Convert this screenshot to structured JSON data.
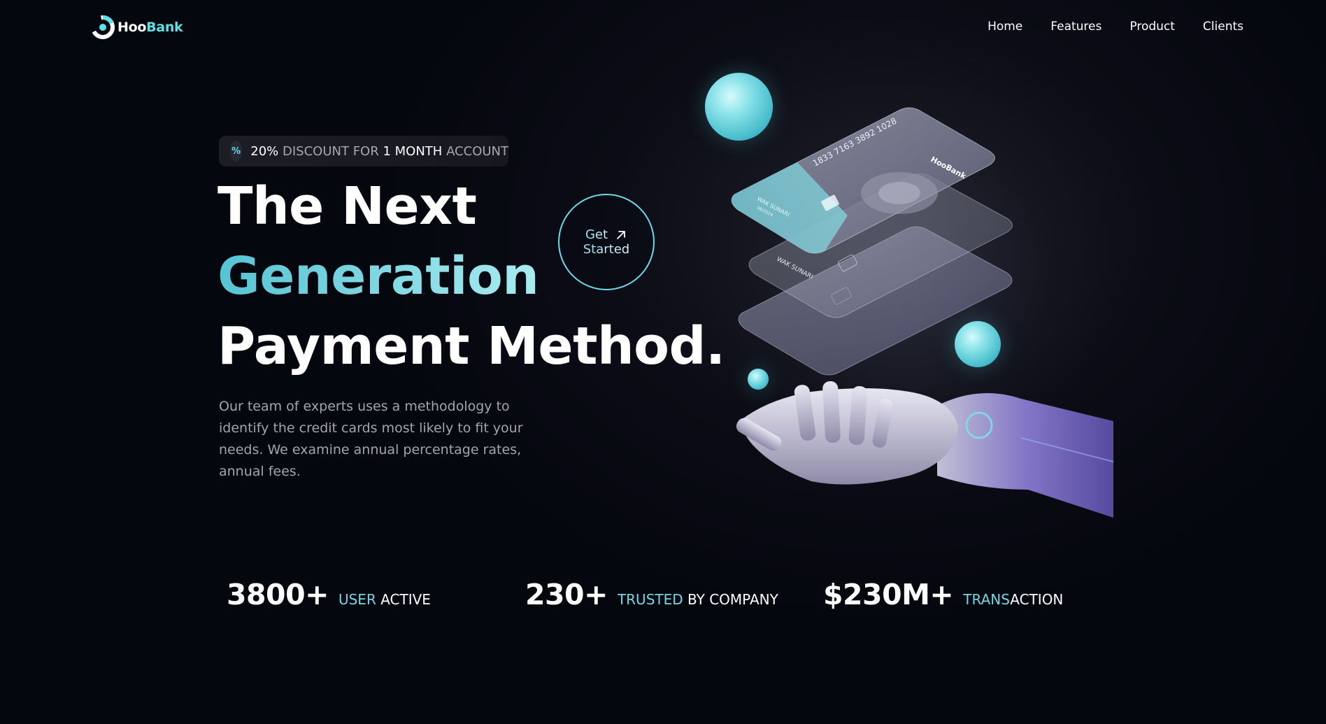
{
  "brand": {
    "name_part1": "Hoo",
    "name_part2": "Bank",
    "accent": "#5ce1e6"
  },
  "nav": {
    "items": [
      {
        "label": "Home"
      },
      {
        "label": "Features"
      },
      {
        "label": "Product"
      },
      {
        "label": "Clients"
      }
    ]
  },
  "hero": {
    "badge": {
      "icon": "discount-icon",
      "percent": "20%",
      "text1": "DISCOUNT FOR",
      "duration": "1 MONTH",
      "text2": "ACCOUNT"
    },
    "title_line1": "The Next",
    "title_line2": "Generation",
    "title_line3": "Payment Method.",
    "description": "Our team of experts uses a methodology to identify the credit cards most likely to fit your needs. We examine annual percentage rates, annual fees.",
    "cta": {
      "line1": "Get",
      "line2": "Started",
      "icon": "arrow-up-right-icon"
    }
  },
  "art": {
    "card_number": "1833 7163 3892 1028",
    "card_brand": "HooBank",
    "card_holder": "WAK SUNARI",
    "card_expiry": "08/2024"
  },
  "stats": [
    {
      "value": "3800+",
      "label_accent": "USER",
      "label_rest": "ACTIVE"
    },
    {
      "value": "230+",
      "label_accent": "TRUSTED",
      "label_rest": "BY COMPANY"
    },
    {
      "value": "$230M+",
      "label_accent": "TRANS",
      "label_rest": "ACTION"
    }
  ]
}
